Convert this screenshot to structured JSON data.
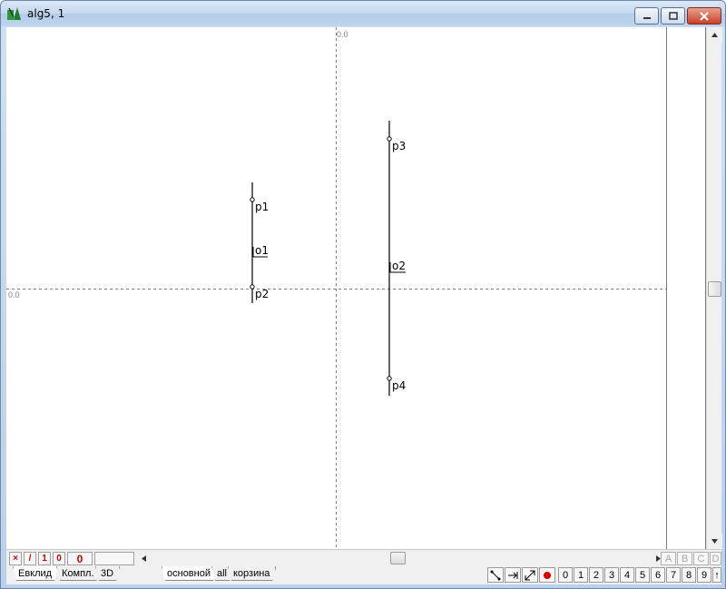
{
  "window": {
    "title": "alg5, 1"
  },
  "canvas": {
    "axis_top_label": "0.0",
    "axis_left_label": "0.0",
    "points": [
      {
        "label": "p1"
      },
      {
        "label": "p2"
      },
      {
        "label": "p3"
      },
      {
        "label": "p4"
      }
    ],
    "objects": [
      {
        "label": "o1"
      },
      {
        "label": "o2"
      }
    ]
  },
  "bottom_bar": {
    "mini_buttons": [
      "×",
      "/",
      "1",
      "0",
      "0"
    ],
    "column_letters": [
      "A",
      "B",
      "C",
      "D"
    ],
    "tabs_left": [
      "Евклид",
      "Компл.",
      "3D"
    ],
    "tabs_layers": [
      "основной",
      "all",
      "корзина"
    ],
    "tool_icons": [
      "line-tool-icon",
      "arrow-tool-icon",
      "diagonal-tool-icon",
      "point-tool-icon"
    ],
    "number_buttons": [
      "0",
      "1",
      "2",
      "3",
      "4",
      "5",
      "6",
      "7",
      "8",
      "9",
      "↑"
    ]
  },
  "colors": {
    "accent_red": "#d00000",
    "axis_gray": "#808080"
  }
}
